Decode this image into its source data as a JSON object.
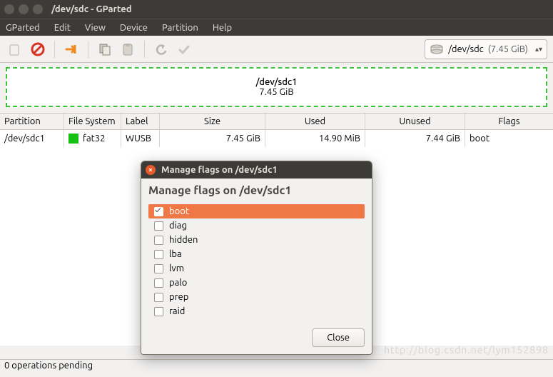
{
  "window": {
    "title": "/dev/sdc - GParted"
  },
  "menu": {
    "gparted": "GParted",
    "edit": "Edit",
    "view": "View",
    "device": "Device",
    "partition": "Partition",
    "help": "Help"
  },
  "device_selector": {
    "device": "/dev/sdc",
    "size": "(7.45 GiB)"
  },
  "graph": {
    "name": "/dev/sdc1",
    "size": "7.45 GiB"
  },
  "table": {
    "headers": {
      "partition": "Partition",
      "filesystem": "File System",
      "label": "Label",
      "size": "Size",
      "used": "Used",
      "unused": "Unused",
      "flags": "Flags"
    },
    "rows": [
      {
        "partition": "/dev/sdc1",
        "filesystem": "fat32",
        "label": "WUSB",
        "size": "7.45 GiB",
        "used": "14.90 MiB",
        "unused": "7.44 GiB",
        "flags": "boot"
      }
    ]
  },
  "dialog": {
    "title": "Manage flags on /dev/sdc1",
    "heading": "Manage flags on /dev/sdc1",
    "flags": [
      {
        "name": "boot",
        "checked": true,
        "selected": true
      },
      {
        "name": "diag",
        "checked": false,
        "selected": false
      },
      {
        "name": "hidden",
        "checked": false,
        "selected": false
      },
      {
        "name": "lba",
        "checked": false,
        "selected": false
      },
      {
        "name": "lvm",
        "checked": false,
        "selected": false
      },
      {
        "name": "palo",
        "checked": false,
        "selected": false
      },
      {
        "name": "prep",
        "checked": false,
        "selected": false
      },
      {
        "name": "raid",
        "checked": false,
        "selected": false
      }
    ],
    "close_label": "Close"
  },
  "status": {
    "pending": "0 operations pending"
  },
  "watermark": "http://blog.csdn.net/lym152898"
}
